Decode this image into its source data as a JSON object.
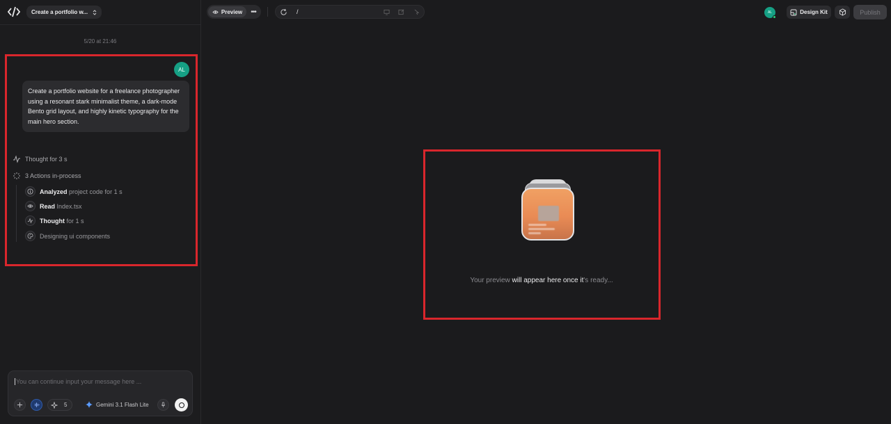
{
  "project": {
    "title": "Create a portfolio w..."
  },
  "chat": {
    "timestamp": "5/20 at 21:46",
    "user_initials": "AL",
    "message": "Create a portfolio website for a freelance photographer using a resonant stark minimalist theme, a dark-mode Bento grid layout, and highly kinetic typography for the main hero section.",
    "thought": "Thought for 3 s",
    "actions_status": "3 Actions in-process",
    "actions": [
      {
        "verb": "Analyzed",
        "detail": "project code for 1 s",
        "icon": "info-icon"
      },
      {
        "verb": "Read",
        "detail": "Index.tsx",
        "icon": "eye-icon"
      },
      {
        "verb": "Thought",
        "detail": "for 1 s",
        "icon": "pulse-icon"
      },
      {
        "verb": "",
        "detail": "Designing ui components",
        "icon": "palette-icon"
      }
    ]
  },
  "composer": {
    "placeholder": "You can continue input your message here ...",
    "count": "5",
    "model": "Gemini 3.1 Flash Lite"
  },
  "toolbar": {
    "preview_label": "Preview",
    "path": "/",
    "avatar_initials": "AL",
    "design_kit_label": "Design Kit",
    "publish_label": "Publish"
  },
  "preview": {
    "msg_a": "Your preview ",
    "msg_b": "will ",
    "msg_c": "appear here once it",
    "msg_d": "'s ",
    "msg_e": "ready..."
  },
  "colors": {
    "accent_avatar": "#16a085",
    "annotation": "#d9262c",
    "background": "#1b1b1d"
  }
}
